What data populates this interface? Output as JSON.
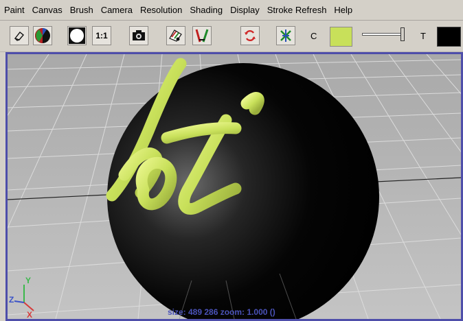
{
  "menu": [
    "Paint",
    "Canvas",
    "Brush",
    "Camera",
    "Resolution",
    "Shading",
    "Display",
    "Stroke Refresh",
    "Help"
  ],
  "toolbar": {
    "ratio_label": "1:1",
    "color_label": "C",
    "transparency_label": "T",
    "color_value": "#c8e05a",
    "transparency_color": "#000000",
    "transparency_slider_level": 0.95
  },
  "viewport": {
    "status_text": "size: 489  286 zoom: 1.000  ()",
    "axis_labels": {
      "y": "Y",
      "z": "Z",
      "x": "X"
    },
    "stroke_text": "hot"
  },
  "colors": {
    "viewport_border": "#4e4eaa",
    "grid_bg": "#b6b6b6",
    "stroke": "#c8e05a",
    "status": "#4a52b8"
  },
  "icons": [
    "eraser-icon",
    "shaded-sphere-icon",
    "white-circle-icon",
    "camera-icon",
    "brush-stroke-icon",
    "paint-effects-icon",
    "refresh-icon",
    "wrap-icon"
  ]
}
